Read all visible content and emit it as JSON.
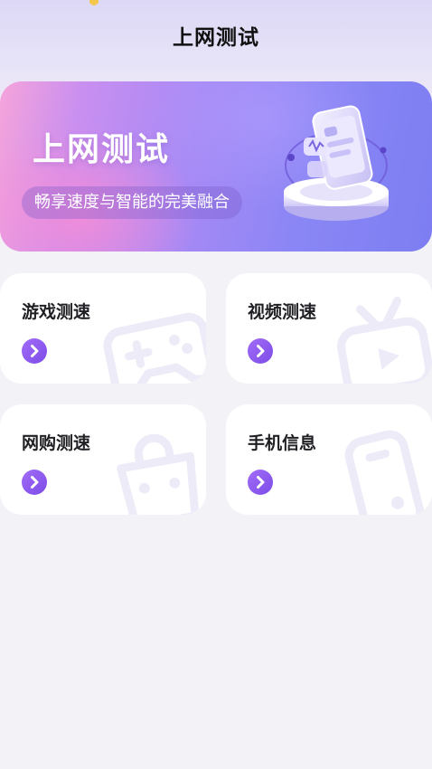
{
  "header": {
    "title": "上网测试"
  },
  "banner": {
    "title": "上网测试",
    "subtitle": "畅享速度与智能的完美融合",
    "art_icon": "phone-hologram-illustration"
  },
  "cards": [
    {
      "label": "游戏测速",
      "icon": "gamepad-icon",
      "arrow_icon": "chevron-right-icon"
    },
    {
      "label": "视频测速",
      "icon": "tv-play-icon",
      "arrow_icon": "chevron-right-icon"
    },
    {
      "label": "网购测速",
      "icon": "shopping-bag-icon",
      "arrow_icon": "chevron-right-icon"
    },
    {
      "label": "手机信息",
      "icon": "mobile-phone-icon",
      "arrow_icon": "chevron-right-icon"
    }
  ],
  "colors": {
    "accent": "#8a5cf0",
    "page_background": "#f3f3f7",
    "card_background": "#ffffff",
    "banner_gradient_start": "#f6a4da",
    "banner_gradient_end": "#7d7ef2"
  }
}
